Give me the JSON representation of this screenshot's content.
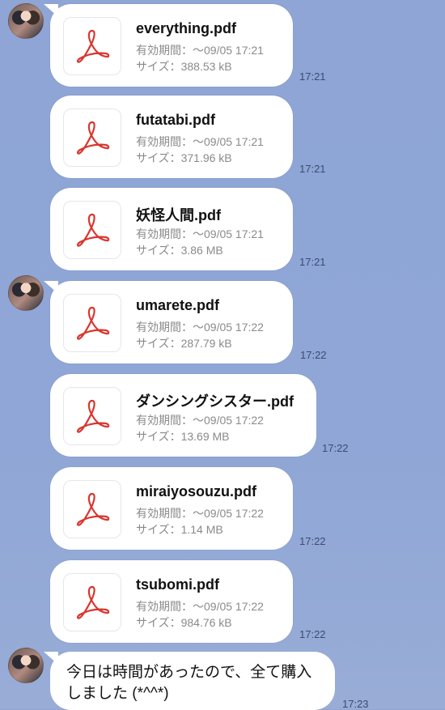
{
  "messages": [
    {
      "filename": "everything.pdf",
      "validity": "有効期間：〜09/05 17:21",
      "size": "サイズ：388.53 kB",
      "time": "17:21"
    },
    {
      "filename": "futatabi.pdf",
      "validity": "有効期間：〜09/05 17:21",
      "size": "サイズ：371.96 kB",
      "time": "17:21"
    },
    {
      "filename": "妖怪人間.pdf",
      "validity": "有効期間：〜09/05 17:21",
      "size": "サイズ：3.86 MB",
      "time": "17:21"
    },
    {
      "filename": "umarete.pdf",
      "validity": "有効期間：〜09/05 17:22",
      "size": "サイズ：287.79 kB",
      "time": "17:22"
    },
    {
      "filename": "ダンシングシスター.pdf",
      "validity": "有効期間：〜09/05 17:22",
      "size": "サイズ：13.69 MB",
      "time": "17:22"
    },
    {
      "filename": "miraiyosouzu.pdf",
      "validity": "有効期間：〜09/05 17:22",
      "size": "サイズ：1.14 MB",
      "time": "17:22"
    },
    {
      "filename": "tsubomi.pdf",
      "validity": "有効期間：〜09/05 17:22",
      "size": "サイズ：984.76 kB",
      "time": "17:22"
    }
  ],
  "text_message": {
    "body": "今日は時間があったので、全て購入しました (*^^*)",
    "time": "17:23"
  },
  "icons": {
    "avatar": "user-avatar",
    "file": "pdf-file-icon"
  },
  "colors": {
    "background": "#8fa6d6",
    "bubble": "#ffffff",
    "pdf_icon": "#d9362f",
    "time_text": "#3b4c72",
    "meta_text": "#8a8a8a"
  }
}
